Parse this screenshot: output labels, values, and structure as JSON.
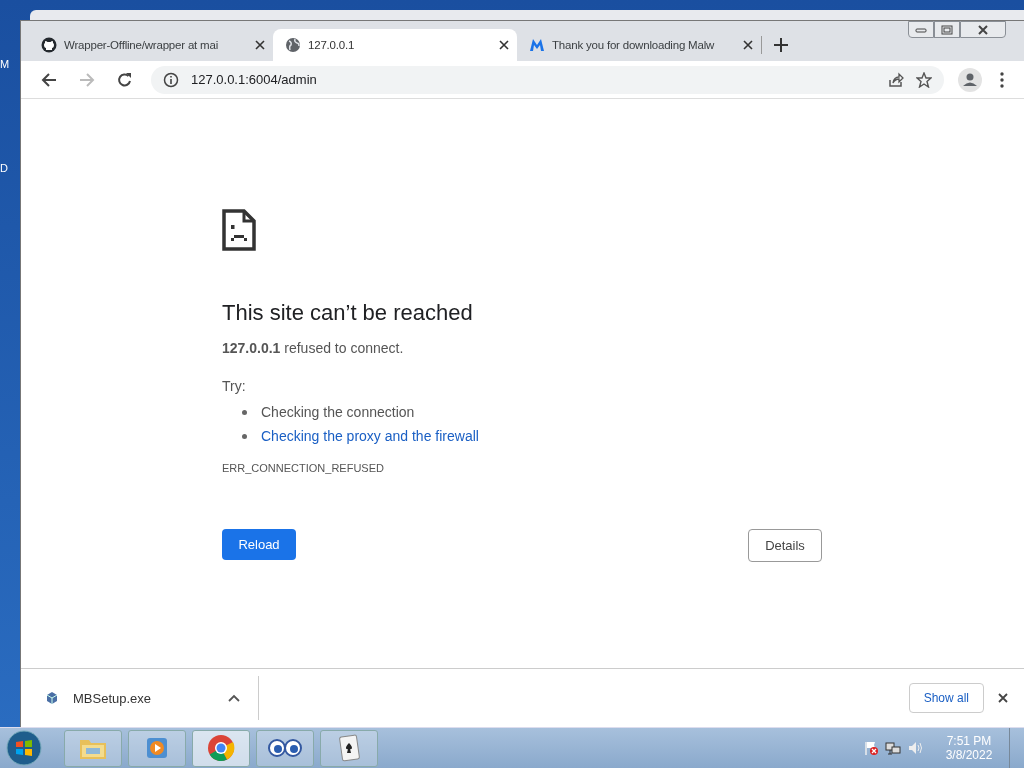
{
  "desktop": {
    "labels": [
      "M",
      "D"
    ]
  },
  "tabs": [
    {
      "title": "Wrapper-Offline/wrapper at mai",
      "kind": "github",
      "selected": false
    },
    {
      "title": "127.0.0.1",
      "kind": "globe",
      "selected": true
    },
    {
      "title": "Thank you for downloading Malw",
      "kind": "m-logo",
      "selected": false
    }
  ],
  "address_bar": {
    "url": "127.0.0.1:6004/admin"
  },
  "error_page": {
    "heading": "This site can’t be reached",
    "message": "**127.0.0.1** refused to connect.",
    "try_label": "Try:",
    "suggestions": [
      {
        "text": "Checking the connection",
        "kind": "text"
      },
      {
        "text": "Checking the proxy and the firewall",
        "kind": "link"
      }
    ],
    "error_code": "ERR_CONNECTION_REFUSED",
    "reload_button": "Reload",
    "details_button": "Details"
  },
  "download_bar": {
    "file": "MBSetup.exe",
    "show_all": "Show all"
  },
  "taskbar": {
    "apps": [
      {
        "kind": "explorer",
        "active": false
      },
      {
        "kind": "media",
        "active": false
      },
      {
        "kind": "chrome",
        "active": true
      },
      {
        "kind": "eyes",
        "active": false
      },
      {
        "kind": "cards",
        "active": false
      }
    ],
    "time": "7:51 PM",
    "date": "3/8/2022"
  }
}
